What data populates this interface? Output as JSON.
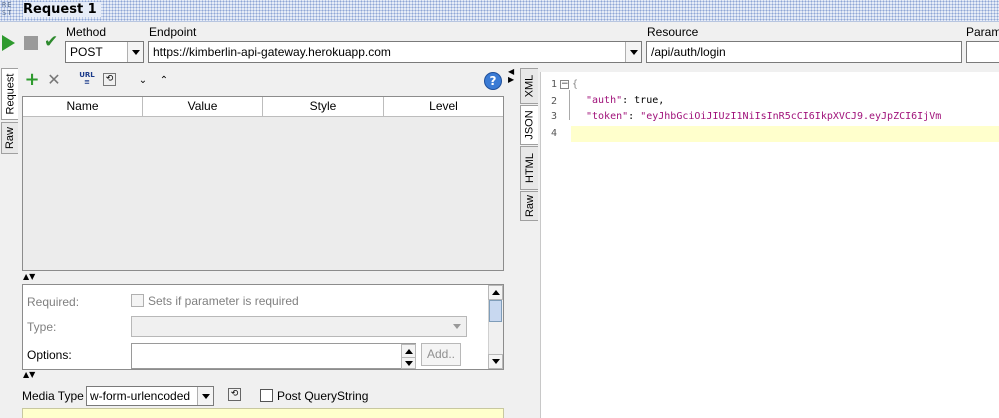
{
  "window": {
    "logo": "RE\nST",
    "title": "Request 1"
  },
  "toolbar": {
    "method_label": "Method",
    "method_value": "POST",
    "endpoint_label": "Endpoint",
    "endpoint_value": "https://kimberlin-api-gateway.herokuapp.com",
    "resource_label": "Resource",
    "resource_value": "/api/auth/login",
    "params_label": "Param"
  },
  "left_tabs": {
    "request": "Request",
    "raw": "Raw"
  },
  "params_table": {
    "columns": [
      "Name",
      "Value",
      "Style",
      "Level"
    ]
  },
  "details": {
    "required_label": "Required:",
    "required_checkbox_label": "Sets if parameter is required",
    "type_label": "Type:",
    "options_label": "Options:",
    "add_button": "Add.."
  },
  "media": {
    "label": "Media Type",
    "value": "w-form-urlencoded",
    "post_querystring_label": "Post QueryString"
  },
  "right_tabs": {
    "xml": "XML",
    "json": "JSON",
    "html": "HTML",
    "raw": "Raw"
  },
  "editor": {
    "line_numbers": [
      "1",
      "2",
      "3",
      "4"
    ],
    "fold_marker": "−",
    "line1": "{",
    "line2_key": "\"auth\"",
    "line2_rest": ": true,",
    "line3_key": "\"token\"",
    "line3_sep": ": ",
    "line3_value": "\"eyJhbGciOiJIUzI1NiIsInR5cCI6IkpXVCJ9.eyJpZCI6IjVm"
  },
  "colors": {
    "accent_green": "#2e9a2e",
    "json_string": "#a0127a",
    "current_line": "#ffffcc"
  }
}
